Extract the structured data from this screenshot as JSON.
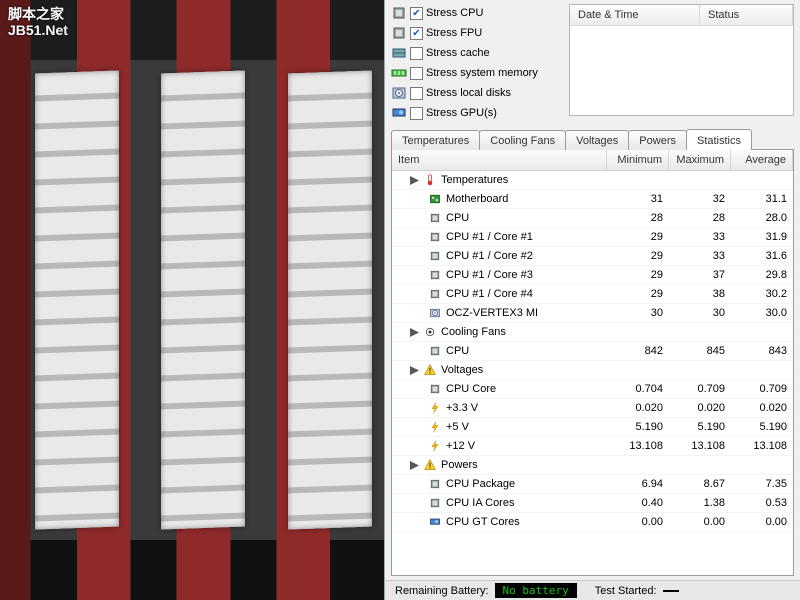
{
  "watermark": {
    "line1": "脚本之家",
    "line2": "JB51.Net"
  },
  "stress": {
    "items": [
      {
        "id": "cpu",
        "label": "Stress CPU",
        "checked": true,
        "icon": "cpu-icon"
      },
      {
        "id": "fpu",
        "label": "Stress FPU",
        "checked": true,
        "icon": "cpu-icon"
      },
      {
        "id": "cache",
        "label": "Stress cache",
        "checked": false,
        "icon": "cache-icon"
      },
      {
        "id": "mem",
        "label": "Stress system memory",
        "checked": false,
        "icon": "memory-icon"
      },
      {
        "id": "disk",
        "label": "Stress local disks",
        "checked": false,
        "icon": "disk-icon"
      },
      {
        "id": "gpu",
        "label": "Stress GPU(s)",
        "checked": false,
        "icon": "gpu-icon"
      }
    ]
  },
  "log": {
    "headers": {
      "datetime": "Date & Time",
      "status": "Status"
    }
  },
  "tabs": {
    "items": [
      "Temperatures",
      "Cooling Fans",
      "Voltages",
      "Powers",
      "Statistics"
    ],
    "active": 4
  },
  "grid": {
    "headers": {
      "item": "Item",
      "min": "Minimum",
      "max": "Maximum",
      "avg": "Average"
    },
    "groups": [
      {
        "name": "Temperatures",
        "icon": "temp-icon",
        "rows": [
          {
            "label": "Motherboard",
            "icon": "board-icon",
            "min": "31",
            "max": "32",
            "avg": "31.1"
          },
          {
            "label": "CPU",
            "icon": "chip-icon",
            "min": "28",
            "max": "28",
            "avg": "28.0"
          },
          {
            "label": "CPU #1 / Core #1",
            "icon": "chip-icon",
            "min": "29",
            "max": "33",
            "avg": "31.9"
          },
          {
            "label": "CPU #1 / Core #2",
            "icon": "chip-icon",
            "min": "29",
            "max": "33",
            "avg": "31.6"
          },
          {
            "label": "CPU #1 / Core #3",
            "icon": "chip-icon",
            "min": "29",
            "max": "37",
            "avg": "29.8"
          },
          {
            "label": "CPU #1 / Core #4",
            "icon": "chip-icon",
            "min": "29",
            "max": "38",
            "avg": "30.2"
          },
          {
            "label": "OCZ-VERTEX3 MI",
            "icon": "disk-icon",
            "min": "30",
            "max": "30",
            "avg": "30.0"
          }
        ]
      },
      {
        "name": "Cooling Fans",
        "icon": "fan-icon",
        "rows": [
          {
            "label": "CPU",
            "icon": "chip-icon",
            "min": "842",
            "max": "845",
            "avg": "843"
          }
        ]
      },
      {
        "name": "Voltages",
        "icon": "warn-icon",
        "rows": [
          {
            "label": "CPU Core",
            "icon": "chip-icon",
            "min": "0.704",
            "max": "0.709",
            "avg": "0.709"
          },
          {
            "label": "+3.3 V",
            "icon": "bolt-icon",
            "min": "0.020",
            "max": "0.020",
            "avg": "0.020"
          },
          {
            "label": "+5 V",
            "icon": "bolt-icon",
            "min": "5.190",
            "max": "5.190",
            "avg": "5.190"
          },
          {
            "label": "+12 V",
            "icon": "bolt-icon",
            "min": "13.108",
            "max": "13.108",
            "avg": "13.108"
          }
        ]
      },
      {
        "name": "Powers",
        "icon": "warn-icon",
        "rows": [
          {
            "label": "CPU Package",
            "icon": "chip-icon",
            "min": "6.94",
            "max": "8.67",
            "avg": "7.35"
          },
          {
            "label": "CPU IA Cores",
            "icon": "chip-icon",
            "min": "0.40",
            "max": "1.38",
            "avg": "0.53"
          },
          {
            "label": "CPU GT Cores",
            "icon": "gpu-icon",
            "min": "0.00",
            "max": "0.00",
            "avg": "0.00"
          }
        ]
      }
    ]
  },
  "status": {
    "battery_label": "Remaining Battery:",
    "battery_value": "No battery",
    "test_label": "Test Started:",
    "test_value": ""
  }
}
